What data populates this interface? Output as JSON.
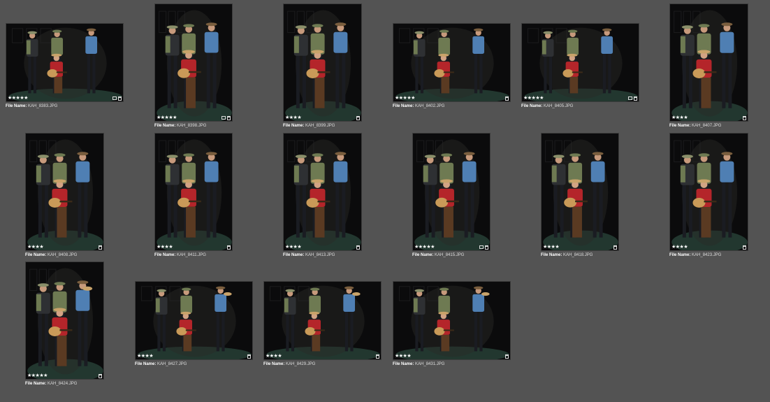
{
  "filename_label": "File Name:",
  "colors": {
    "background": "#535353",
    "stage_dark": "#0b0b0c",
    "stage_floor": "#2c4a3f",
    "plaid_shirt": "#b4252a",
    "denim": "#4f7fb3",
    "khaki_vest": "#6e7a52",
    "guitar": "#c99a58"
  },
  "photos": [
    {
      "filename": "KAH_8383.JPG",
      "stars": "★★★★★",
      "icons": [
        "box",
        "trash"
      ],
      "name": "photo-kah-8383"
    },
    {
      "filename": "KAH_8398.JPG",
      "stars": "★★★★★",
      "icons": [
        "box",
        "trash"
      ],
      "name": "photo-kah-8398"
    },
    {
      "filename": "KAH_8399.JPG",
      "stars": "★★★★",
      "icons": [
        "trash"
      ],
      "name": "photo-kah-8399"
    },
    {
      "filename": "KAH_8402.JPG",
      "stars": "★★★★★",
      "icons": [
        "trash"
      ],
      "name": "photo-kah-8402"
    },
    {
      "filename": "KAH_8405.JPG",
      "stars": "★★★★★",
      "icons": [
        "box",
        "trash"
      ],
      "name": "photo-kah-8405"
    },
    {
      "filename": "KAH_8407.JPG",
      "stars": "★★★★",
      "icons": [
        "trash"
      ],
      "name": "photo-kah-8407"
    },
    {
      "filename": "KAH_8408.JPG",
      "stars": "★★★★",
      "icons": [
        "trash"
      ],
      "name": "photo-kah-8408"
    },
    {
      "filename": "KAH_8411.JPG",
      "stars": "★★★★",
      "icons": [
        "trash"
      ],
      "name": "photo-kah-8411"
    },
    {
      "filename": "KAH_8413.JPG",
      "stars": "★★★★",
      "icons": [
        "trash"
      ],
      "name": "photo-kah-8413"
    },
    {
      "filename": "KAH_8415.JPG",
      "stars": "★★★★★",
      "icons": [
        "box",
        "trash"
      ],
      "name": "photo-kah-8415"
    },
    {
      "filename": "KAH_8418.JPG",
      "stars": "★★★★",
      "icons": [
        "trash"
      ],
      "name": "photo-kah-8418"
    },
    {
      "filename": "KAH_8423.JPG",
      "stars": "★★★★",
      "icons": [
        "trash"
      ],
      "name": "photo-kah-8423"
    },
    {
      "filename": "KAH_8424.JPG",
      "stars": "★★★★★",
      "icons": [
        "trash"
      ],
      "name": "photo-kah-8424"
    },
    {
      "filename": "KAH_8427.JPG",
      "stars": "★★★★",
      "icons": [
        "trash"
      ],
      "name": "photo-kah-8427"
    },
    {
      "filename": "KAH_8429.JPG",
      "stars": "★★★★",
      "icons": [
        "trash"
      ],
      "name": "photo-kah-8429"
    },
    {
      "filename": "KAH_8431.JPG",
      "stars": "★★★★",
      "icons": [
        "trash"
      ],
      "name": "photo-kah-8431"
    }
  ]
}
